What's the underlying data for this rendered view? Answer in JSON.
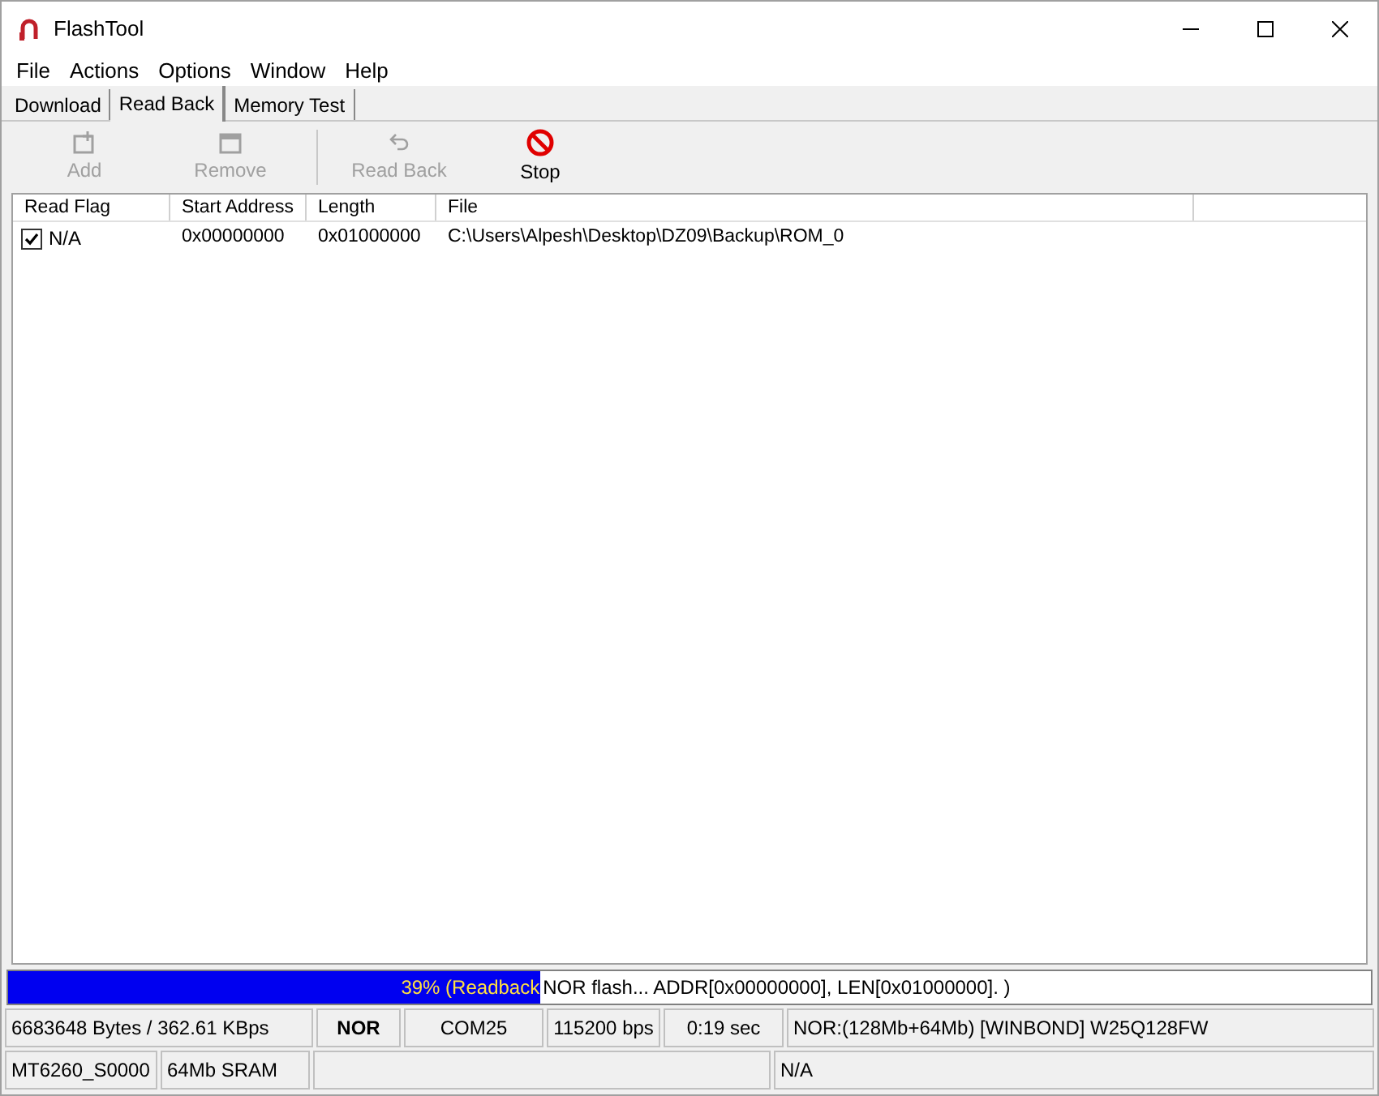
{
  "window": {
    "title": "FlashTool"
  },
  "menu": [
    "File",
    "Actions",
    "Options",
    "Window",
    "Help"
  ],
  "tabs": [
    {
      "label": "Download",
      "selected": false
    },
    {
      "label": "Read Back",
      "selected": true
    },
    {
      "label": "Memory Test",
      "selected": false
    }
  ],
  "toolbar": [
    {
      "kind": "add",
      "label": "Add",
      "disabled": true
    },
    {
      "kind": "remove",
      "label": "Remove",
      "disabled": true
    },
    {
      "kind": "readback",
      "label": "Read Back",
      "disabled": true
    },
    {
      "kind": "stop",
      "label": "Stop",
      "disabled": false
    }
  ],
  "table": {
    "columns": [
      "Read Flag",
      "Start Address",
      "Length",
      "File"
    ],
    "rows": [
      {
        "checked": true,
        "cells": [
          "N/A",
          "0x00000000",
          "0x01000000",
          "C:\\Users\\Alpesh\\Desktop\\DZ09\\Backup\\ROM_0"
        ]
      }
    ]
  },
  "progress": {
    "level": 0.39,
    "fill_text": "39% (Readback",
    "message": "NOR flash... ADDR[0x00000000], LEN[0x01000000]. )"
  },
  "status_rows": [
    [
      {
        "kind": "text",
        "text": "6683648 Bytes / 362.61 KBps",
        "bold": false
      },
      {
        "kind": "text",
        "text": "NOR",
        "bold": true
      },
      {
        "kind": "text",
        "text": "COM25",
        "bold": false
      },
      {
        "kind": "text",
        "text": "115200 bps",
        "bold": false
      },
      {
        "kind": "text",
        "text": "0:19 sec",
        "bold": false
      },
      {
        "kind": "text",
        "text": "NOR:(128Mb+64Mb) [WINBOND] W25Q128FW",
        "bold": false
      }
    ],
    [
      {
        "kind": "text",
        "text": "MT6260_S0000",
        "bold": false
      },
      {
        "kind": "text",
        "text": "64Mb SRAM",
        "bold": false
      },
      {
        "kind": "empty"
      },
      {
        "kind": "text",
        "text": "N/A",
        "bold": false
      }
    ]
  ]
}
